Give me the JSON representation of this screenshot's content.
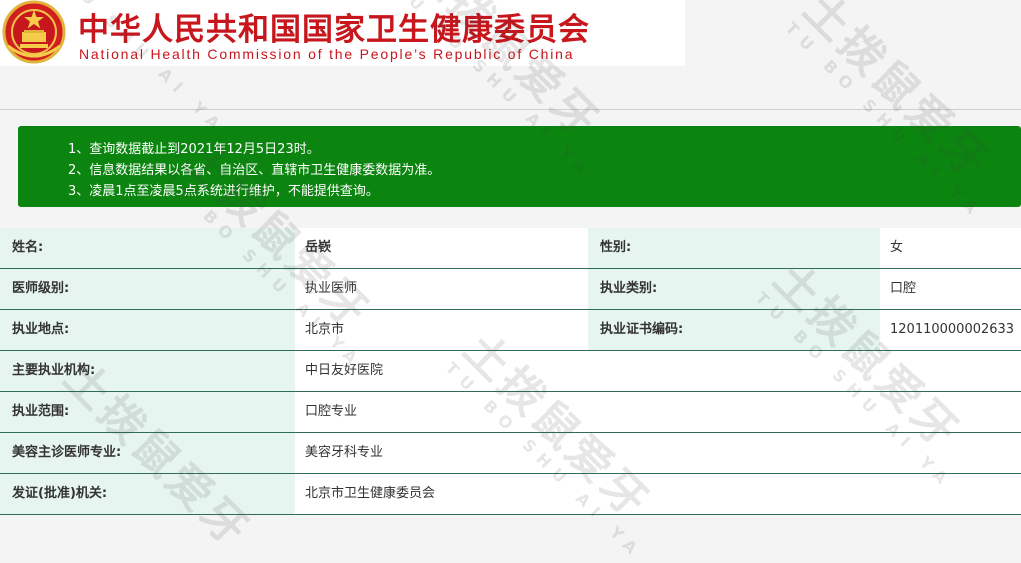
{
  "header": {
    "title_cn": "中华人民共和国国家卫生健康委员会",
    "title_en": "National Health Commission of the People’s Republic of China"
  },
  "notice": {
    "lines": [
      "1、查询数据截止到2021年12月5日23时。",
      "2、信息数据结果以各省、自治区、直辖市卫生健康委数据为准。",
      "3、凌晨1点至凌晨5点系统进行维护，不能提供查询。"
    ]
  },
  "record": {
    "name_label": "姓名:",
    "name_value": "岳嵚",
    "gender_label": "性别:",
    "gender_value": "女",
    "level_label": "医师级别:",
    "level_value": "执业医师",
    "category_label": "执业类别:",
    "category_value": "口腔",
    "location_label": "执业地点:",
    "location_value": "北京市",
    "cert_label": "执业证书编码:",
    "cert_value": "120110000002633",
    "institution_label": "主要执业机构:",
    "institution_value": "中日友好医院",
    "scope_label": "执业范围:",
    "scope_value": "口腔专业",
    "cosmetic_label": "美容主诊医师专业:",
    "cosmetic_value": "美容牙科专业",
    "issuer_label": "发证(批准)机关:",
    "issuer_value": "北京市卫生健康委员会"
  },
  "watermark": {
    "text_cn": "土拨鼠爱牙",
    "text_en": "TU BO SHU AI YA"
  },
  "colors": {
    "brand_red": "#c8161d",
    "notice_green": "#0b850f",
    "label_bg": "#e6f5ef"
  }
}
